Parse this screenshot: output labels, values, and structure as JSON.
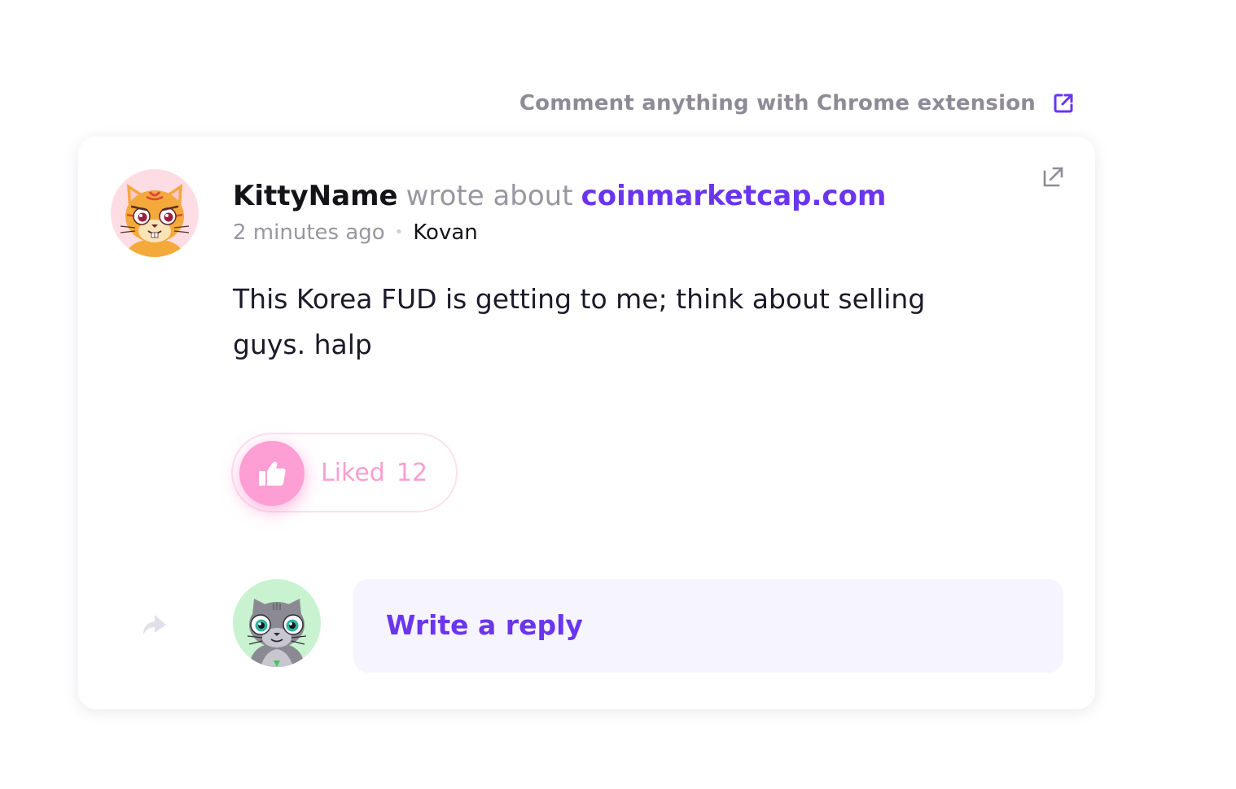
{
  "header": {
    "extension_link": "Comment anything with Chrome extension",
    "extension_icon": "external-link-icon",
    "accent_color": "#6a35ee"
  },
  "comment": {
    "author": "KittyName",
    "wrote_about": "wrote about",
    "site": "coinmarketcap.com",
    "time_ago": "2 minutes ago",
    "separator": "•",
    "network": "Kovan",
    "body": "This Korea FUD is getting to me; think about selling guys. halp",
    "open_icon": "open-in-new-icon",
    "author_avatar": "orange-kitty-avatar"
  },
  "like": {
    "label": "Liked",
    "count": "12",
    "icon": "thumbs-up-icon",
    "color": "#fd9fd4"
  },
  "reply": {
    "placeholder": "Write a reply",
    "arrow_icon": "reply-arrow-icon",
    "user_avatar": "grey-kitty-avatar"
  }
}
